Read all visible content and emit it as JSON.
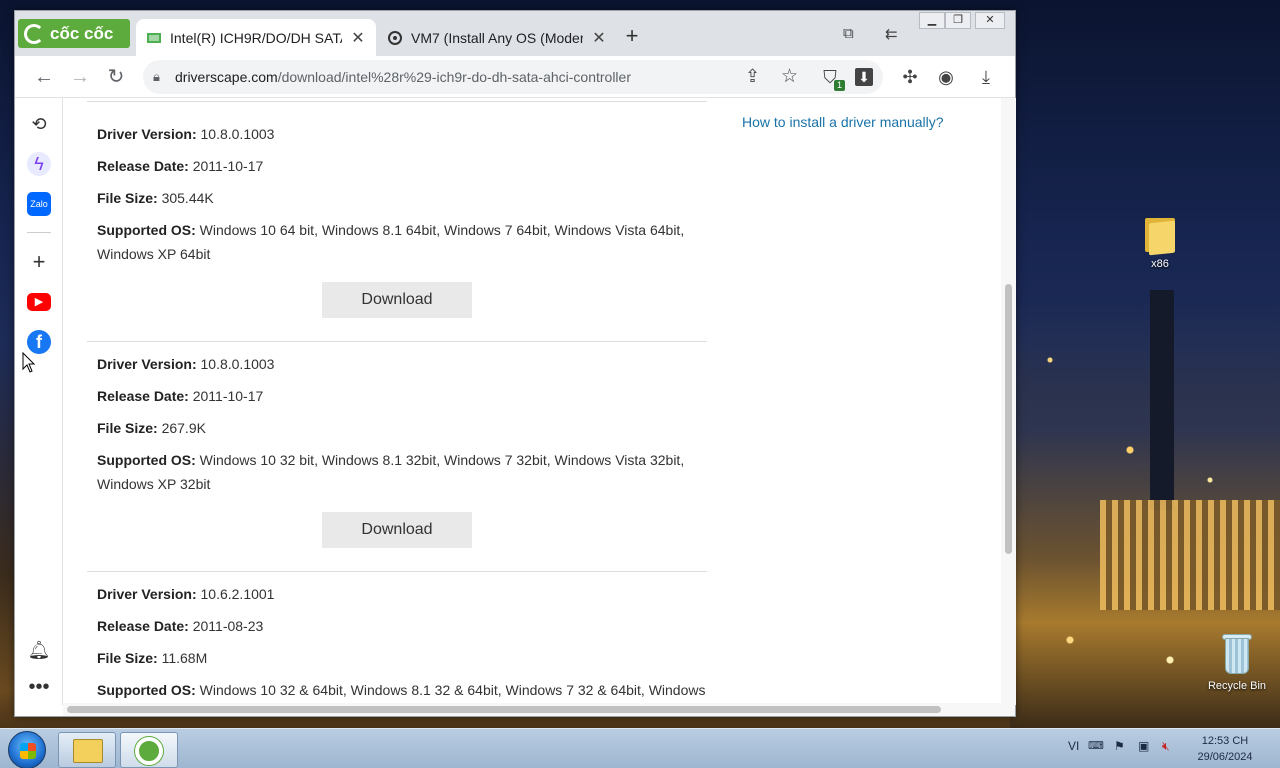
{
  "window": {
    "brand": "cốc cốc",
    "tabs": [
      {
        "title": "Intel(R) ICH9R/DO/DH SATA",
        "active": true
      },
      {
        "title": "VM7 (Install Any OS (Modern",
        "active": false
      }
    ],
    "new_tab": "+"
  },
  "address": {
    "host": "driverscape.com",
    "path": "/download/intel%28r%29-ich9r-do-dh-sata-ahci-controller"
  },
  "content": {
    "help_link": "How to install a driver manually?",
    "labels": {
      "version": "Driver Version:",
      "date": "Release Date:",
      "size": "File Size:",
      "os": "Supported OS:"
    },
    "download_label": "Download",
    "drivers": [
      {
        "version": "10.8.0.1003",
        "date": "2011-10-17",
        "size": "305.44K",
        "os": "Windows 10 64 bit, Windows 8.1 64bit, Windows 7 64bit, Windows Vista 64bit, Windows XP 64bit"
      },
      {
        "version": "10.8.0.1003",
        "date": "2011-10-17",
        "size": "267.9K",
        "os": "Windows 10 32 bit, Windows 8.1 32bit, Windows 7 32bit, Windows Vista 32bit, Windows XP 32bit"
      },
      {
        "version": "10.6.2.1001",
        "date": "2011-08-23",
        "size": "11.68M",
        "os": "Windows 10 32 & 64bit, Windows 8.1 32 & 64bit, Windows 7 32 & 64bit, Windows"
      }
    ]
  },
  "desktop": {
    "folder_label": "x86",
    "recycle_label": "Recycle Bin"
  },
  "taskbar": {
    "language": "VI",
    "time": "12:53 CH",
    "date": "29/06/2024"
  }
}
